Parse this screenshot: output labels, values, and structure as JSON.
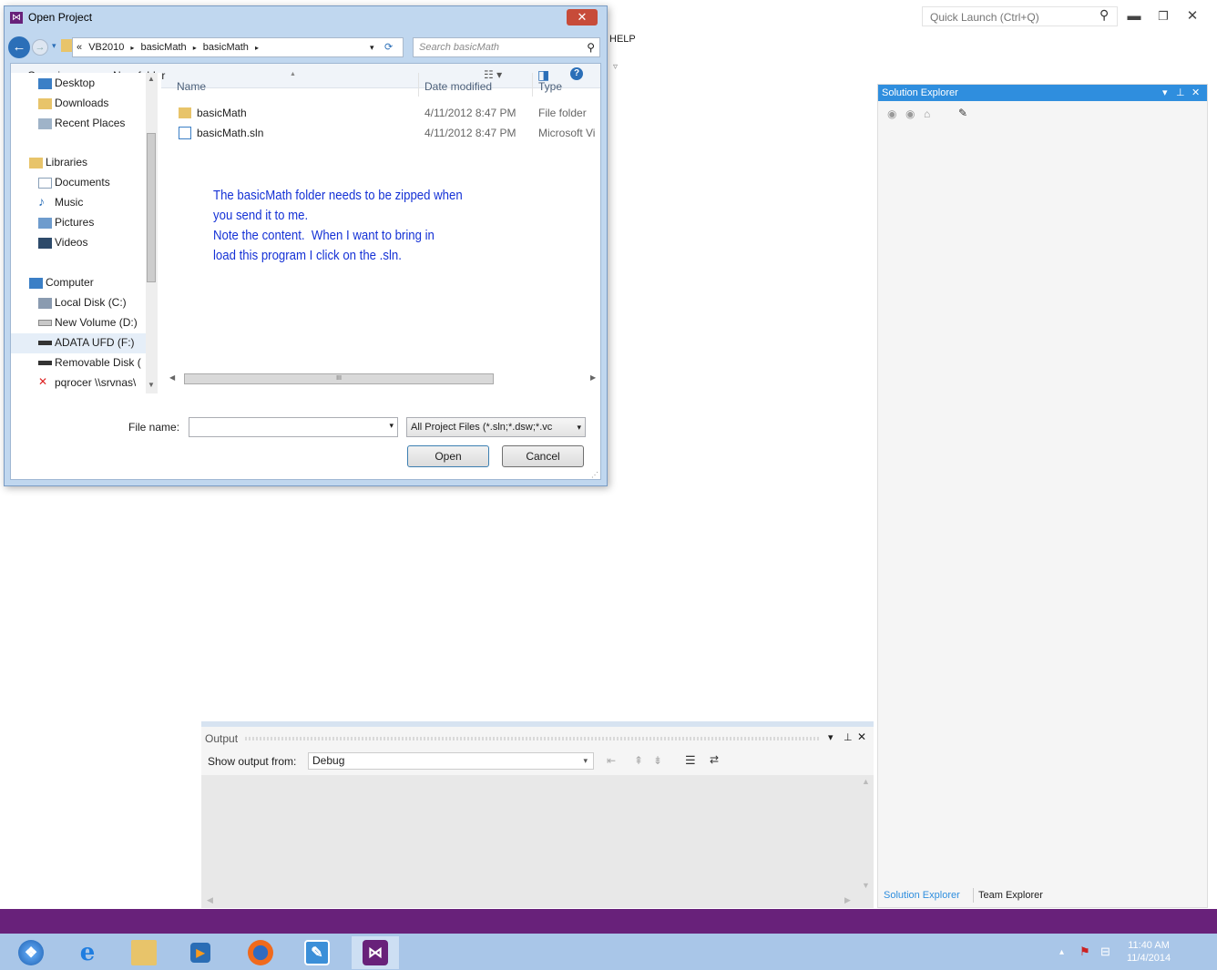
{
  "vs": {
    "quick_launch_placeholder": "Quick Launch (Ctrl+Q)",
    "menu_help": "HELP",
    "solution_explorer": {
      "title": "Solution Explorer",
      "tabs": [
        "Solution Explorer",
        "Team Explorer"
      ]
    },
    "output": {
      "title": "Output",
      "show_from_label": "Show output from:",
      "show_from_value": "Debug"
    }
  },
  "dialog": {
    "title": "Open Project",
    "breadcrumb": [
      "«",
      "VB2010",
      "basicMath",
      "basicMath"
    ],
    "search_placeholder": "Search basicMath",
    "organize_label": "Organize ▾",
    "new_folder_label": "New folder",
    "nav_items": [
      {
        "label": "Desktop",
        "icon": "desktop-icon"
      },
      {
        "label": "Downloads",
        "icon": "downloads-icon"
      },
      {
        "label": "Recent Places",
        "icon": "recent-places-icon"
      },
      {
        "label": "Libraries",
        "icon": "libraries-icon"
      },
      {
        "label": "Documents",
        "icon": "documents-icon"
      },
      {
        "label": "Music",
        "icon": "music-icon"
      },
      {
        "label": "Pictures",
        "icon": "pictures-icon"
      },
      {
        "label": "Videos",
        "icon": "videos-icon"
      },
      {
        "label": "Computer",
        "icon": "computer-icon"
      },
      {
        "label": "Local Disk (C:)",
        "icon": "local-disk-icon"
      },
      {
        "label": "New Volume (D:)",
        "icon": "drive-icon"
      },
      {
        "label": "ADATA UFD (F:)",
        "icon": "usb-drive-icon"
      },
      {
        "label": "Removable Disk (",
        "icon": "usb-drive-icon"
      },
      {
        "label": "pqrocer \\\\srvnas\\",
        "icon": "network-drive-icon"
      }
    ],
    "columns": [
      "Name",
      "Date modified",
      "Type"
    ],
    "files": [
      {
        "name": "basicMath",
        "date": "4/11/2012 8:47 PM",
        "type": "File folder",
        "icon": "folder-icon"
      },
      {
        "name": "basicMath.sln",
        "date": "4/11/2012 8:47 PM",
        "type": "Microsoft Vi",
        "icon": "solution-file-icon"
      }
    ],
    "note": "The basicMath folder needs to be zipped when\nyou send it to me.\nNote the content.  When I want to bring in\nload this program I click on the .sln.",
    "file_name_label": "File name:",
    "file_name_value": "",
    "filter_value": "All Project Files (*.sln;*.dsw;*.vc",
    "open_label": "Open",
    "cancel_label": "Cancel",
    "scroll_glyph": "III"
  },
  "taskbar": {
    "time": "11:40 AM",
    "date": "11/4/2014",
    "apps": [
      "start-orb-icon",
      "internet-explorer-icon",
      "file-explorer-icon",
      "media-player-icon",
      "firefox-icon",
      "notepad-icon",
      "visual-studio-icon"
    ]
  },
  "colors": {
    "vs_purple": "#68217a",
    "pane_title_blue": "#2f8ede",
    "note_blue": "#1532d6",
    "taskbar_blue": "#a9c6e8"
  }
}
